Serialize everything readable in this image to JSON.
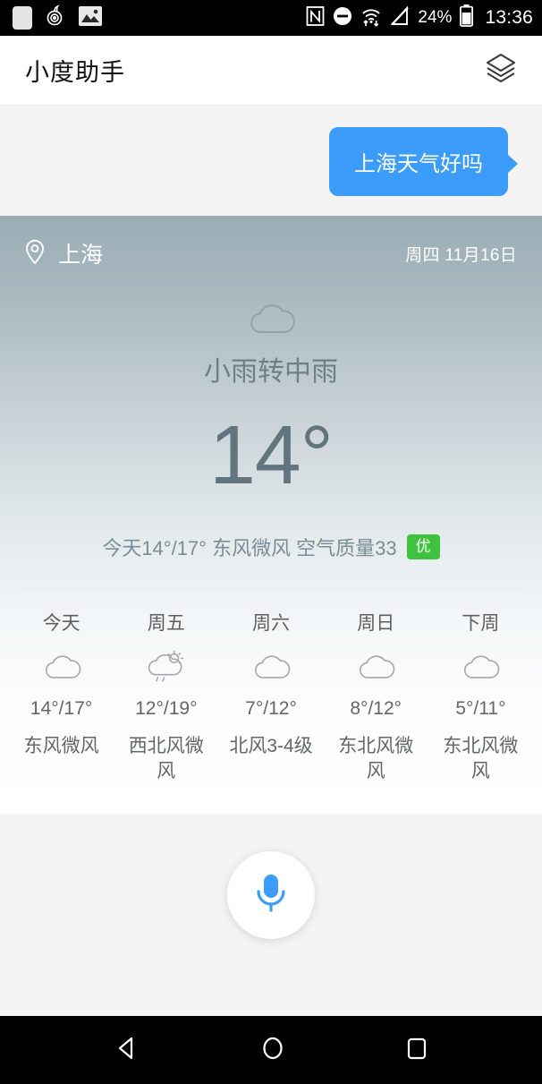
{
  "status_bar": {
    "left_icons": [
      "blank-notification-icon",
      "app-swirl-icon",
      "image-icon"
    ],
    "right_icons": [
      "nfc-icon",
      "do-not-disturb-icon",
      "wifi-icon",
      "no-sim-icon",
      "battery-icon"
    ],
    "battery_percent": "24%",
    "clock": "13:36"
  },
  "header": {
    "title": "小度助手",
    "right_icon": "layers-icon"
  },
  "chat": {
    "user_message": "上海天气好吗",
    "bubble_color": "#3c9cfa"
  },
  "weather": {
    "location_icon": "location-pin-icon",
    "city": "上海",
    "date": "周四 11月16日",
    "condition_icon": "cloud-icon",
    "condition": "小雨转中雨",
    "temperature": "14°",
    "summary": "今天14°/17° 东风微风 空气质量33",
    "aqi_badge": "优",
    "aqi_badge_color": "#3fc23f",
    "forecast": [
      {
        "day": "今天",
        "icon": "cloud-icon",
        "temp": "14°/17°",
        "wind": "东风微风"
      },
      {
        "day": "周五",
        "icon": "sun-cloud-rain-icon",
        "temp": "12°/19°",
        "wind": "西北风微风"
      },
      {
        "day": "周六",
        "icon": "cloud-icon",
        "temp": "7°/12°",
        "wind": "北风3-4级"
      },
      {
        "day": "周日",
        "icon": "cloud-icon",
        "temp": "8°/12°",
        "wind": "东北风微风"
      },
      {
        "day": "下周",
        "icon": "cloud-icon",
        "temp": "5°/11°",
        "wind": "东北风微风"
      }
    ]
  },
  "mic": {
    "icon": "microphone-icon",
    "color": "#3c9cfa"
  },
  "nav_bar": {
    "back": "back-triangle-icon",
    "home": "home-circle-icon",
    "recents": "recents-square-icon"
  }
}
